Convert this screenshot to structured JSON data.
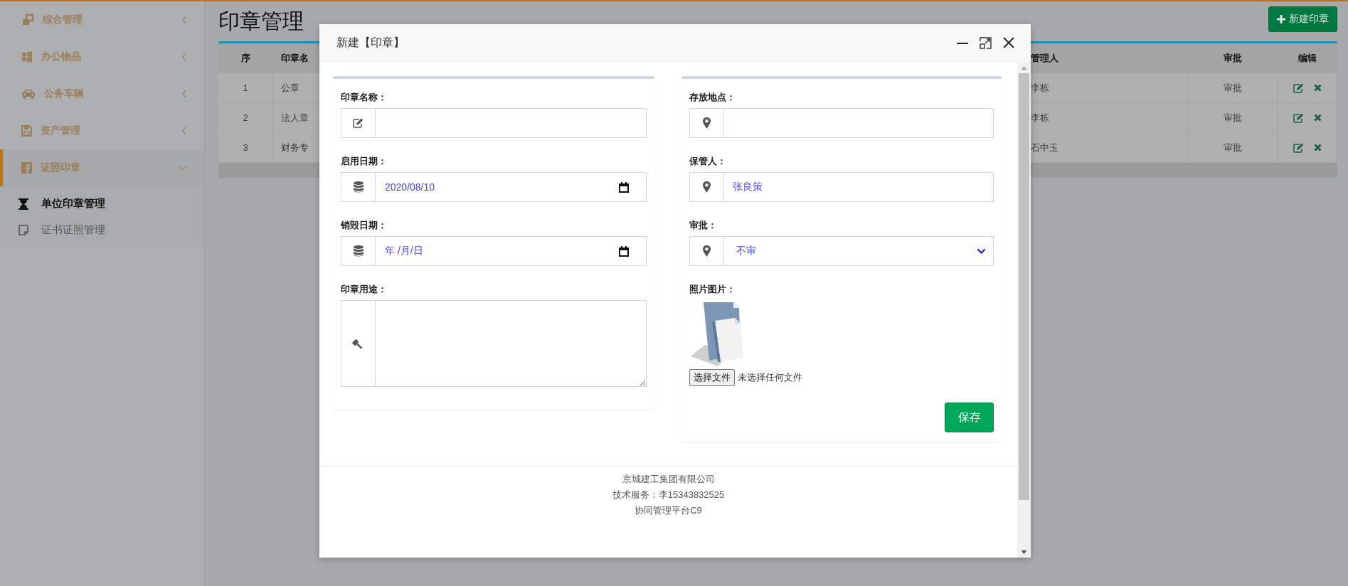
{
  "sidebar": {
    "items": [
      {
        "label": "综合管理",
        "selected": false,
        "expanded": false
      },
      {
        "label": "办公物品",
        "selected": false,
        "expanded": false
      },
      {
        "label": "公务车辆",
        "selected": false,
        "expanded": false
      },
      {
        "label": "资产管理",
        "selected": false,
        "expanded": false
      },
      {
        "label": "证照印章",
        "selected": true,
        "expanded": true,
        "children": [
          {
            "label": "单位印章管理",
            "selected": true
          },
          {
            "label": "证书证照管理",
            "selected": false
          }
        ]
      }
    ]
  },
  "page": {
    "title": "印章管理",
    "new_button": "新建印章"
  },
  "table": {
    "columns": [
      "序",
      "印章名",
      "管理人",
      "审批",
      "编辑"
    ],
    "rows": [
      {
        "cells": [
          "1",
          "公章",
          "李栋",
          "审批"
        ]
      },
      {
        "cells": [
          "2",
          "法人章",
          "李栋",
          "审批"
        ]
      },
      {
        "cells": [
          "3",
          "财务专",
          "石中玉",
          "审批"
        ]
      }
    ]
  },
  "dialog": {
    "title": "新建【印章】",
    "left_fields": [
      {
        "kind": "text",
        "label": "印章名称："
      },
      {
        "kind": "date",
        "label": "启用日期：",
        "value": "2020/08/10"
      },
      {
        "kind": "date",
        "label": "销毁日期：",
        "placeholder": "年 /月/日"
      },
      {
        "kind": "textarea",
        "label": "印章用途："
      }
    ],
    "right_fields": [
      {
        "kind": "text",
        "label": "存放地点："
      },
      {
        "kind": "text",
        "label": "保管人：",
        "value": "张良策"
      },
      {
        "kind": "select",
        "label": "审批：",
        "value": "不审"
      },
      {
        "kind": "file",
        "label": "照片图片：",
        "button": "选择文件",
        "status": "未选择任何文件"
      }
    ],
    "save_button": "保存",
    "footer": [
      "京城建工集团有限公司",
      "技术服务：李15343832525",
      "协同管理平台C9"
    ]
  }
}
